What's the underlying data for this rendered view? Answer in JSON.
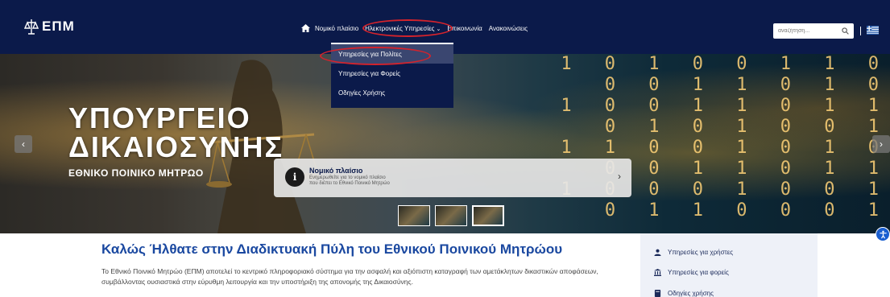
{
  "header": {
    "logo_text": "ΕΠΜ",
    "nav": {
      "legal": "Νομικό πλαίσιο",
      "eservices": "Ηλεκτρονικές Υπηρεσίες",
      "contact": "Επικοινωνία",
      "announcements": "Ανακοινώσεις"
    },
    "search_placeholder": "αναζήτηση...",
    "accent_color": "#d3232c",
    "bg_color": "#0b1a4a"
  },
  "dropdown": {
    "items": [
      "Υπηρεσίες για Πολίτες",
      "Υπηρεσίες για Φορείς",
      "Οδηγίες Χρήσης"
    ]
  },
  "hero": {
    "title_line1": "ΥΠΟΥΡΓΕΙΟ",
    "title_line2": "ΔΙΚΑΙΟΣΥΝΗΣ",
    "subtitle": "ΕΘΝΙΚΟ ΠΟΙΝΙΚΟ ΜΗΤΡΩΟ",
    "card": {
      "icon_letter": "i",
      "title": "Νομικό πλαίσιο",
      "text_line1": "Ενημερωθείτε για το νομικό πλαίσιο",
      "text_line2": "που διέπει το Εθνικό Ποινικό Μητρώο"
    },
    "prev_arrow": "‹",
    "next_arrow": "›",
    "card_chevron": "›"
  },
  "main": {
    "welcome": "Καλώς Ήλθατε στην Διαδικτυακή Πύλη του Εθνικού Ποινικού Μητρώου",
    "description": "Το Εθνικό Ποινικό Μητρώο (ΕΠΜ) αποτελεί το κεντρικό πληροφοριακό σύστημα για την ασφαλή και αξιόπιστη καταγραφή των αμετάκλητων δικαστικών αποφάσεων, συμβάλλοντας ουσιαστικά στην εύρυθμη λειτουργία και την υποστήριξη της απονομής της Δικαιοσύνης."
  },
  "sidebar": {
    "items": [
      "Υπηρεσίες για χρήστες",
      "Υπηρεσίες για φορείς",
      "Οδηγίες χρήσης"
    ]
  }
}
